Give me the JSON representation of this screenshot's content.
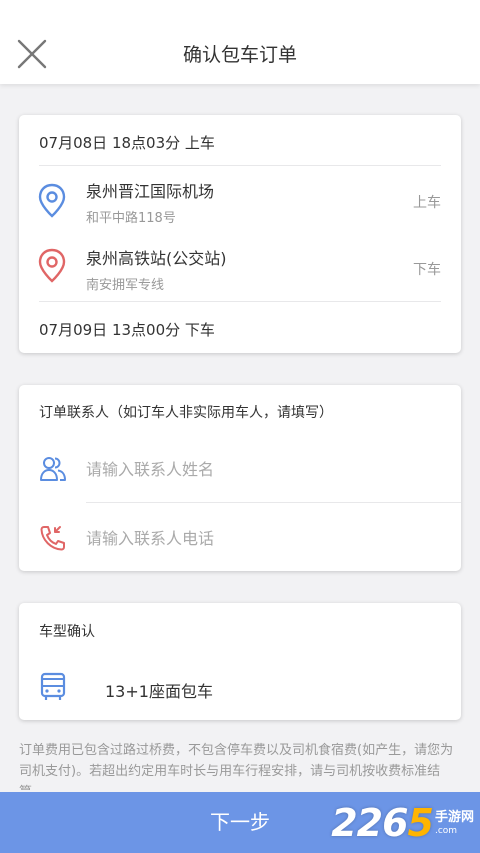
{
  "header": {
    "title": "确认包车订单"
  },
  "trip": {
    "start_time": "07月08日 18点03分 上车",
    "end_time": "07月09日 13点00分 下车",
    "pickup": {
      "name": "泉州晋江国际机场",
      "address": "和平中路118号",
      "tag": "上车",
      "icon": "pickup-location-icon",
      "color": "#5b8de0"
    },
    "dropoff": {
      "name": "泉州高铁站(公交站)",
      "address": "南安拥军专线",
      "tag": "下车",
      "icon": "dropoff-location-icon",
      "color": "#e06666"
    }
  },
  "contact": {
    "title": "订单联系人（如订车人非实际用车人，请填写）",
    "name_field": {
      "value": "",
      "placeholder": "请输入联系人姓名"
    },
    "phone_field": {
      "value": "",
      "placeholder": "请输入联系人电话"
    }
  },
  "vehicle": {
    "title": "车型确认",
    "name": "13+1座面包车"
  },
  "notice": "订单费用已包含过路过桥费，不包含停车费以及司机食宿费(如产生，请您为司机支付)。若超出约定用车时长与用车行程安排，请与司机按收费标准结算。",
  "footer": {
    "next_label": "下一步",
    "accent": "#6c95e6"
  },
  "watermark": {
    "num_a": "226",
    "num_b": "5",
    "cn": "手游网",
    "url": ".com"
  }
}
